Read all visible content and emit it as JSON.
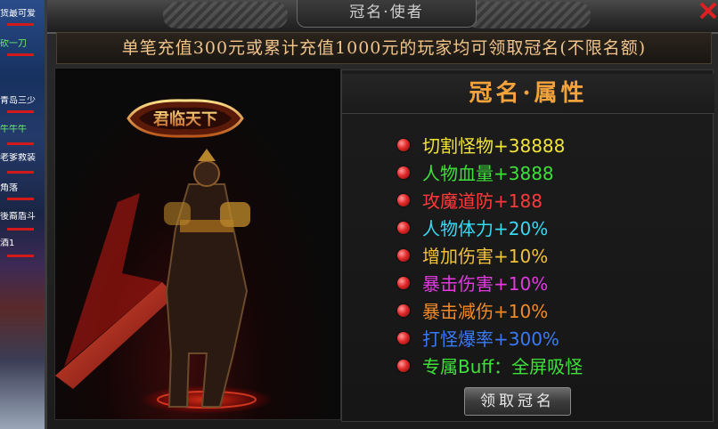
{
  "window": {
    "title": "冠名·使者"
  },
  "notice": "单笔充值300元或累计充值1000元的玩家均可领取冠名(不限名额)",
  "left_strip": {
    "names": [
      "货最可爱",
      "砍一刀",
      "青岛三少",
      "牛牛牛",
      "老爹救装",
      "角落",
      "後裔盾斗",
      "酒1"
    ]
  },
  "badge_text": "君临天下",
  "attributes": {
    "title": "冠名·属性",
    "items": [
      {
        "text": "切割怪物+38888",
        "color": "#f2e43a"
      },
      {
        "text": "人物血量+3888",
        "color": "#3ee03a"
      },
      {
        "text": "攻魔道防+188",
        "color": "#ff3a3a"
      },
      {
        "text": "人物体力+20%",
        "color": "#3ad8f2"
      },
      {
        "text": "增加伤害+10%",
        "color": "#f2c23a"
      },
      {
        "text": "暴击伤害+10%",
        "color": "#e23ae0"
      },
      {
        "text": "暴击减伤+10%",
        "color": "#f28a2a"
      },
      {
        "text": "打怪爆率+300%",
        "color": "#3a7af2"
      },
      {
        "text": "专属Buff：全屏吸怪",
        "color": "#3ee03a"
      }
    ],
    "claim_button": "领取冠名"
  },
  "icons": {
    "close": "close-icon",
    "bullet": "red-orb-icon"
  }
}
